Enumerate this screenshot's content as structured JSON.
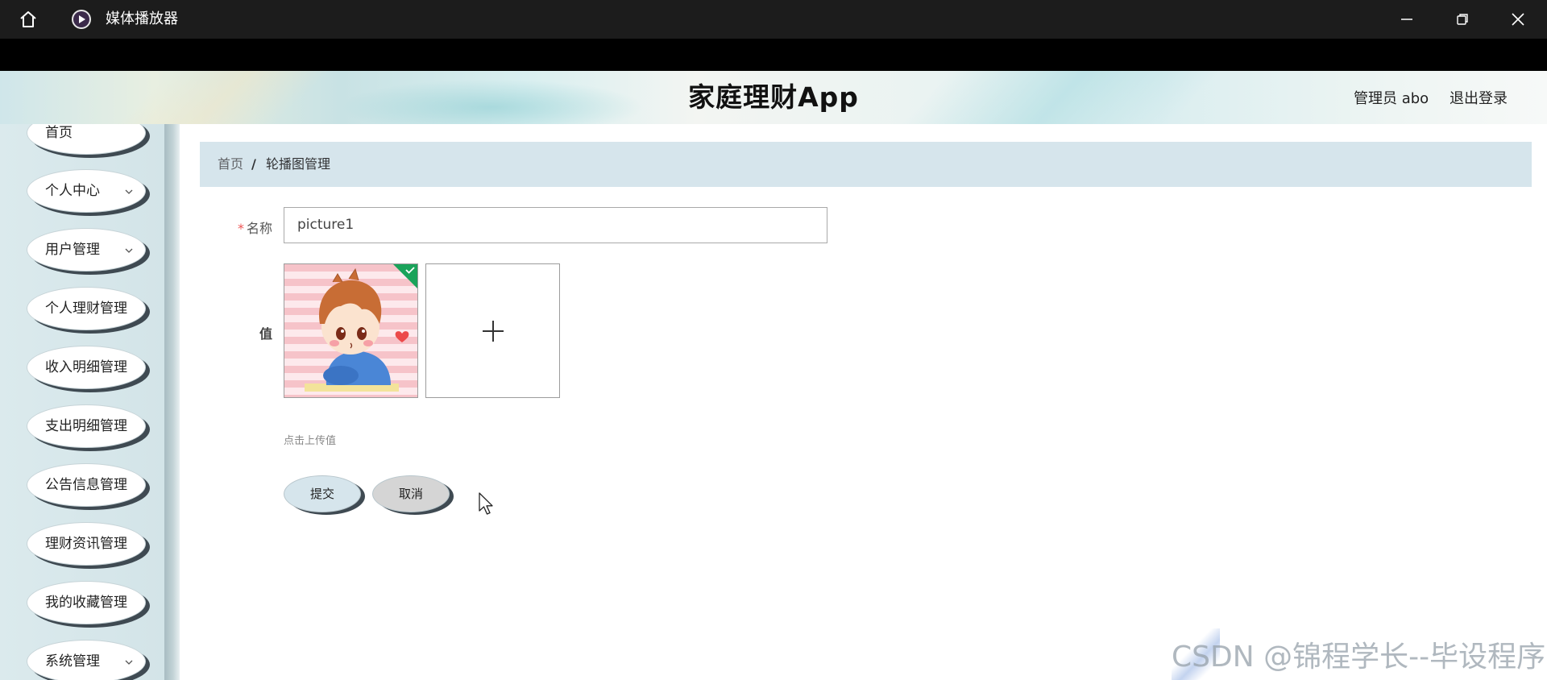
{
  "window": {
    "app_title": "媒体播放器"
  },
  "header": {
    "brand": "家庭理财App",
    "user_label": "管理员 abo",
    "logout_label": "退出登录"
  },
  "sidebar": {
    "items": [
      {
        "label": "首页",
        "has_submenu": false
      },
      {
        "label": "个人中心",
        "has_submenu": true
      },
      {
        "label": "用户管理",
        "has_submenu": true
      },
      {
        "label": "个人理财管理",
        "has_submenu": true
      },
      {
        "label": "收入明细管理",
        "has_submenu": true
      },
      {
        "label": "支出明细管理",
        "has_submenu": true
      },
      {
        "label": "公告信息管理",
        "has_submenu": true
      },
      {
        "label": "理财资讯管理",
        "has_submenu": true
      },
      {
        "label": "我的收藏管理",
        "has_submenu": true
      },
      {
        "label": "系统管理",
        "has_submenu": true
      }
    ]
  },
  "breadcrumb": {
    "home": "首页",
    "separator": "/",
    "current": "轮播图管理"
  },
  "form": {
    "name_label": "名称",
    "name_required_mark": "*",
    "name_value": "picture1",
    "value_label": "值",
    "upload_hint": "点击上传值",
    "upload_status": "success",
    "submit_label": "提交",
    "cancel_label": "取消"
  },
  "watermark": "CSDN @锦程学长--毕设程序",
  "colors": {
    "titlebar": "#1c1c1c",
    "breadcrumb_bg": "#d6e5ec",
    "sidebar_bg": "#d7e7ea",
    "success_badge": "#1aa35a",
    "cancel_bg": "#d5d5d5"
  },
  "icons": {
    "home": "home-icon",
    "app": "media-player-icon",
    "minimize": "minimize-icon",
    "maximize": "restore-icon",
    "close": "close-icon",
    "upload": "plus-icon"
  }
}
